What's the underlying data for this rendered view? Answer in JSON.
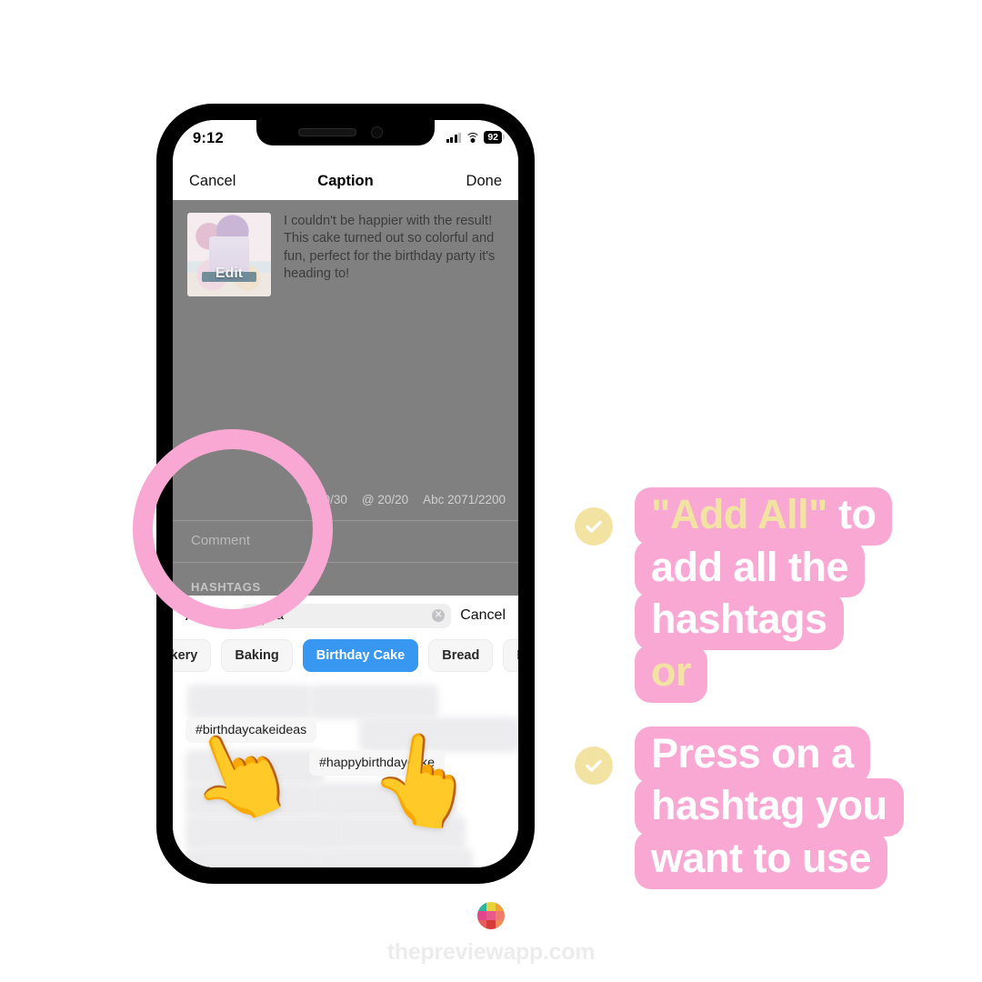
{
  "phone": {
    "status_bar": {
      "time": "9:12",
      "battery": "92",
      "wifi_icon": "wifi-icon",
      "signal_icon": "cellular-signal-icon"
    },
    "nav": {
      "cancel": "Cancel",
      "title": "Caption",
      "done": "Done"
    },
    "editor": {
      "thumb_label": "Edit",
      "caption_text": "I couldn't be happier with the result! This cake turned out so colorful and fun, perfect for the birthday party it's heading to!",
      "counters": [
        "# 30/30",
        "@ 20/20",
        "Abc 2071/2200"
      ],
      "comment_placeholder": "Comment",
      "section_label": "HASHTAGS"
    },
    "sheet": {
      "add_all": "Add All",
      "search_value": "Ca",
      "search_icon": "search-icon",
      "clear_icon": "clear-icon",
      "cancel": "Cancel",
      "chips": [
        {
          "label": "Bakery",
          "active": false
        },
        {
          "label": "Baking",
          "active": false
        },
        {
          "label": "Birthday Cake",
          "active": true
        },
        {
          "label": "Bread",
          "active": false
        },
        {
          "label": "Breakfast",
          "active": false
        }
      ],
      "tags": [
        {
          "label": "#birthdaycakeideas",
          "blurred": false
        },
        {
          "label": "#happybirthdaycake",
          "blurred": false
        }
      ],
      "hand_icon": "pointing-up-hand-icon"
    }
  },
  "annotation": {
    "blocks": [
      {
        "check_icon": "check-circle-icon",
        "lines": [
          {
            "highlight": "\"Add All\"",
            "rest": " to"
          },
          {
            "highlight": "",
            "rest": "add all the"
          },
          {
            "highlight": "",
            "rest": "hashtags"
          },
          {
            "highlight": "or",
            "rest": ""
          }
        ]
      },
      {
        "check_icon": "check-circle-icon",
        "lines": [
          {
            "highlight": "",
            "rest": "Press on a"
          },
          {
            "highlight": "",
            "rest": "hashtag you"
          },
          {
            "highlight": "",
            "rest": "want to use"
          }
        ]
      }
    ],
    "pink": "#f9a8d4",
    "cream": "#f3e3a3"
  },
  "footer": {
    "logo_icon": "preview-app-logo-icon",
    "site": "thepreviewapp.com"
  },
  "highlight_ring": {
    "name": "pink-highlight-ring",
    "color": "#f9a8d4"
  }
}
